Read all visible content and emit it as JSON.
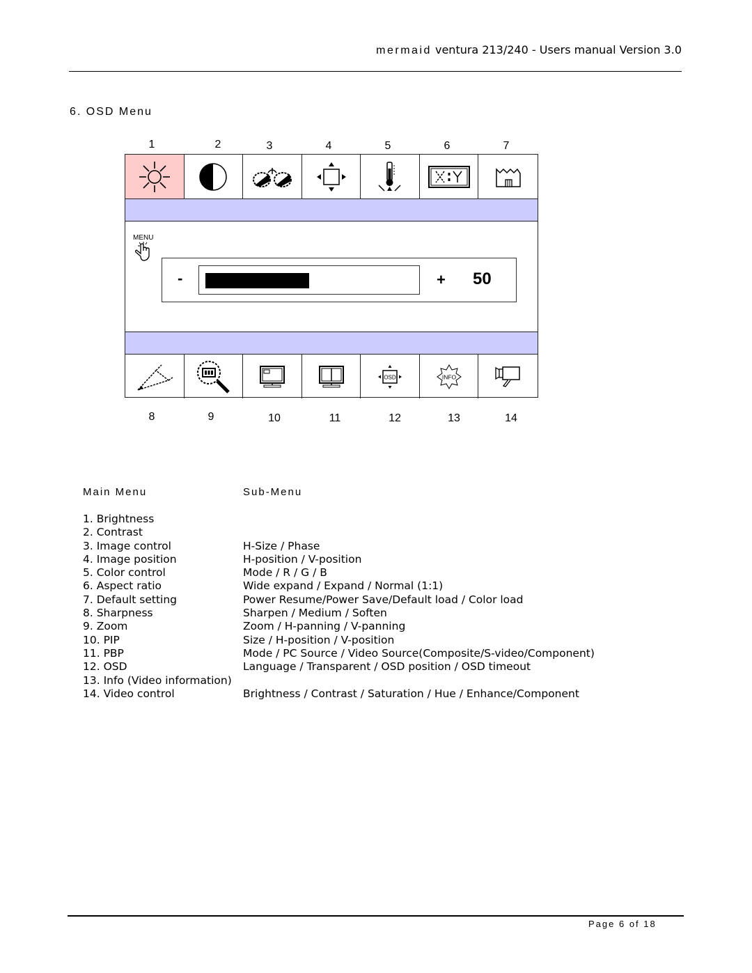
{
  "header": {
    "brand": "mermaid",
    "title": "ventura 213/240 - Users manual Version 3.0"
  },
  "section_title": "6. OSD Menu",
  "osd_diagram": {
    "top_numbers": [
      "1",
      "2",
      "3",
      "4",
      "5",
      "6",
      "7"
    ],
    "bottom_numbers": [
      "8",
      "9",
      "10",
      "11",
      "12",
      "13",
      "14"
    ],
    "top_icons": [
      "brightness-sun-icon",
      "contrast-half-circle-icon",
      "image-control-glasses-icon",
      "image-position-arrows-icon",
      "color-thermometer-icon",
      "aspect-ratio-xy-icon",
      "default-factory-icon"
    ],
    "bottom_icons": [
      "sharpness-icon",
      "zoom-magnifier-icon",
      "pip-monitor-icon",
      "pbp-monitor-icon",
      "osd-icon",
      "info-icon",
      "video-camera-icon"
    ],
    "active_index": 0,
    "colors": {
      "active": "#ffcccc",
      "bar": "#ccccff"
    },
    "menu_label": "MENU",
    "slider": {
      "minus": "-",
      "plus": "+",
      "value": "50",
      "fraction": 0.5
    }
  },
  "table": {
    "main_header": "Main Menu",
    "sub_header": "Sub-Menu",
    "rows": [
      {
        "main": "1. Brightness",
        "sub": ""
      },
      {
        "main": "2. Contrast",
        "sub": ""
      },
      {
        "main": "3. Image control",
        "sub": "H-Size / Phase"
      },
      {
        "main": "4. Image position",
        "sub": "H-position / V-position"
      },
      {
        "main": "5. Color control",
        "sub": "Mode / R / G / B"
      },
      {
        "main": "6. Aspect ratio",
        "sub": "Wide expand / Expand / Normal (1:1)"
      },
      {
        "main": "7. Default setting",
        "sub": "Power Resume/Power Save/Default load / Color load"
      },
      {
        "main": "8. Sharpness",
        "sub": "Sharpen / Medium / Soften"
      },
      {
        "main": "9. Zoom",
        "sub": "Zoom / H-panning / V-panning"
      },
      {
        "main": "10. PIP",
        "sub": "Size / H-position / V-position"
      },
      {
        "main": "11. PBP",
        "sub": "Mode / PC Source / Video Source(Composite/S-video/Component)"
      },
      {
        "main": "12. OSD",
        "sub": "Language / Transparent / OSD position / OSD timeout"
      },
      {
        "main": "13. Info (Video information)",
        "sub": ""
      },
      {
        "main": "14. Video control",
        "sub": "Brightness / Contrast / Saturation / Hue / Enhance/Component"
      }
    ]
  },
  "footer": {
    "page": "Page 6 of 18"
  }
}
